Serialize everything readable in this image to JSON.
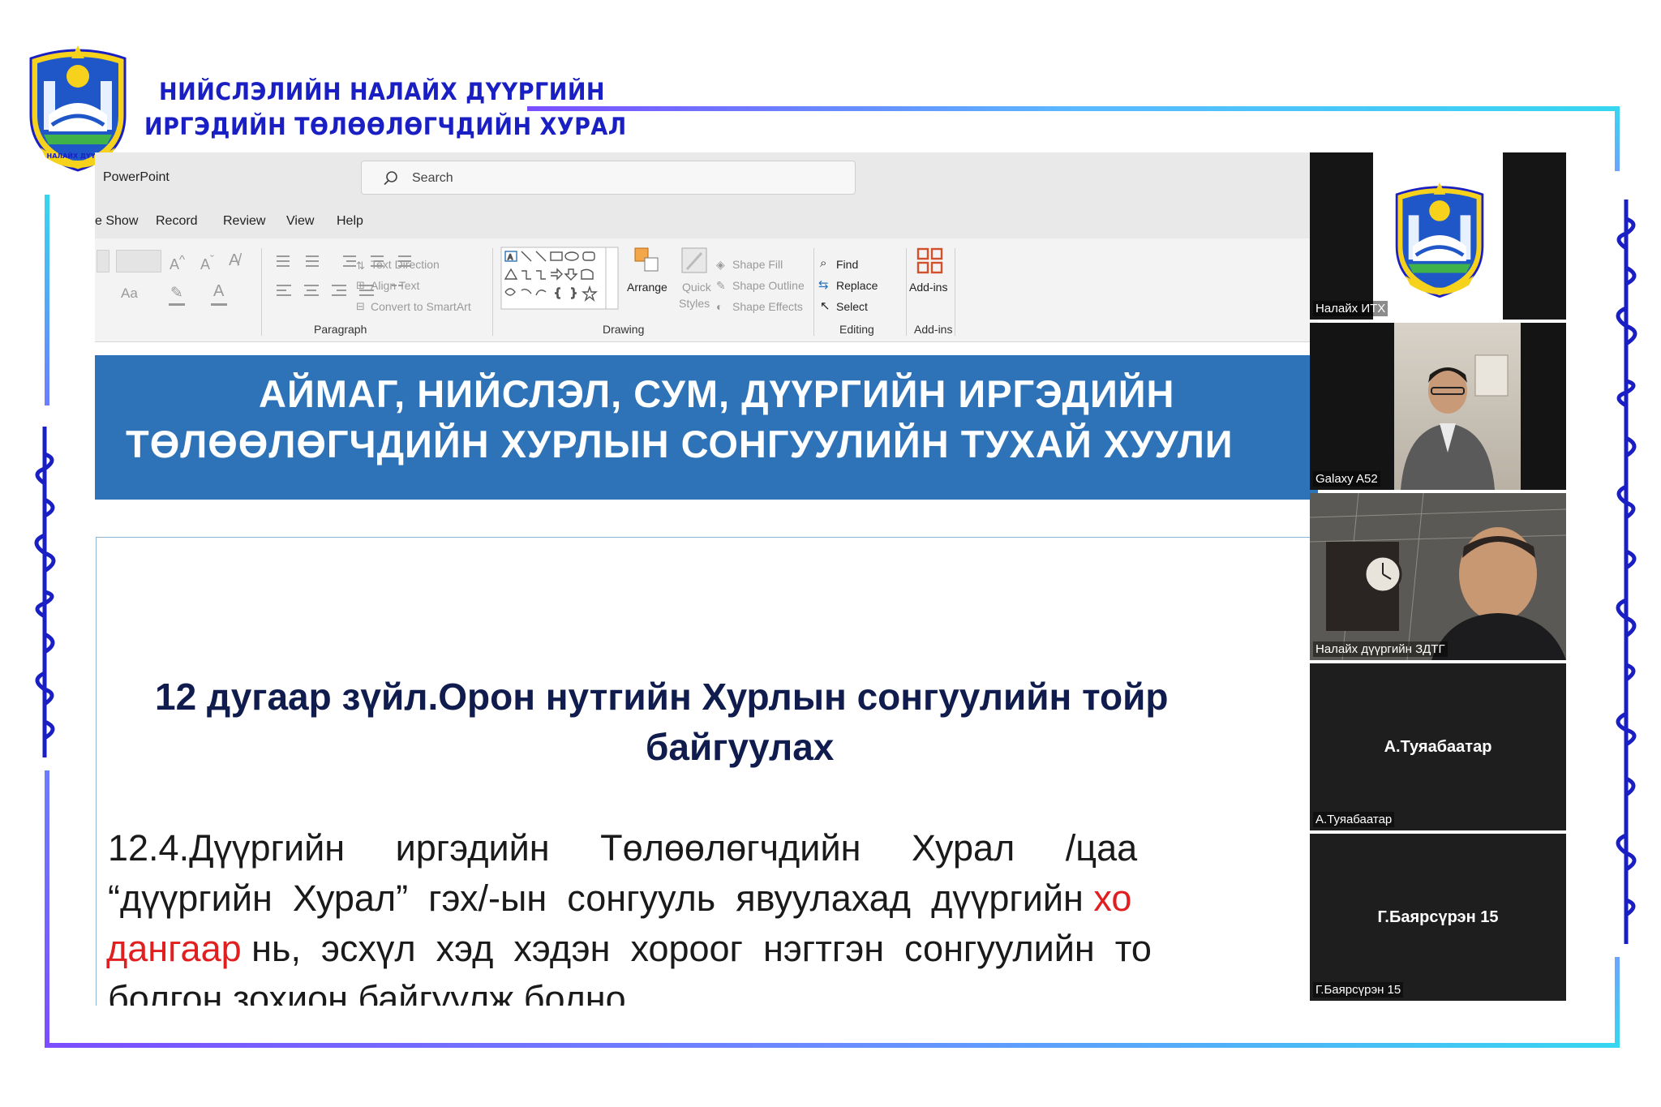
{
  "header": {
    "org_line1": "НИЙСЛЭЛИЙН НАЛАЙХ ДҮҮРГИЙН",
    "org_line2": "ИРГЭДИЙН ТӨЛӨӨЛӨГЧДИЙН ХУРАЛ",
    "logo_ribbon_text": "НАЛАЙХ ДҮҮРЭГ"
  },
  "app": {
    "name": "PowerPoint",
    "search_placeholder": "Search"
  },
  "menu": [
    "e Show",
    "Record",
    "Review",
    "View",
    "Help"
  ],
  "ribbon": {
    "groups": {
      "paragraph": "Paragraph",
      "drawing": "Drawing",
      "editing": "Editing",
      "addins": "Add-ins"
    },
    "font_size_label": "Aa",
    "text_direction": "Text Direction",
    "align_text": "Align Text",
    "convert_smartart": "Convert to SmartArt",
    "arrange": "Arrange",
    "quick_styles_1": "Quick",
    "quick_styles_2": "Styles",
    "shape_fill": "Shape Fill",
    "shape_outline": "Shape Outline",
    "shape_effects": "Shape Effects",
    "find": "Find",
    "replace": "Replace",
    "select": "Select",
    "addins_button": "Add-ins"
  },
  "slide": {
    "title_line1": "АЙМАГ, НИЙСЛЭЛ, СУМ, ДҮҮРГИЙН ИРГЭДИЙН",
    "title_line2": "ТӨЛӨӨЛӨГЧДИЙН ХУРЛЫН СОНГУУЛИЙН ТУХАЙ ХУУЛИ",
    "article_line1": "12 дугаар зүйл.Орон нутгийн Хурлын сонгуулийн тойр",
    "article_line2": "байгуулах",
    "para_line1": "12.4.Дүүргийн     иргэдийн     Төлөөлөгчдийн     Хурал     /цаа",
    "para_line2_a": "“дүүргийн  Хурал”  гэх/-ын  сонгууль  явуулахад  дүүргийн ",
    "para_line2_red": "хо",
    "para_line3_red": "дангаар",
    "para_line3_b": " нь,  эсхүл  хэд  хэдэн  хороог  нэгтгэн  сонгуулийн  то",
    "para_line4": "болгон зохион байгуулж болно"
  },
  "participants": [
    {
      "label": "Налайх ИТХ",
      "center_name": ""
    },
    {
      "label": "Galaxy A52",
      "center_name": ""
    },
    {
      "label": "Налайх дүүргийн ЗДТГ",
      "center_name": ""
    },
    {
      "label": "А.Туяабаатар",
      "center_name": "А.Туяабаатар"
    },
    {
      "label": "Г.Баярсүрэн 15",
      "center_name": "Г.Баярсүрэн 15"
    }
  ],
  "colors": {
    "brand_blue": "#1a1fc4",
    "slide_header": "#2e73b8",
    "highlight_red": "#e02020"
  }
}
